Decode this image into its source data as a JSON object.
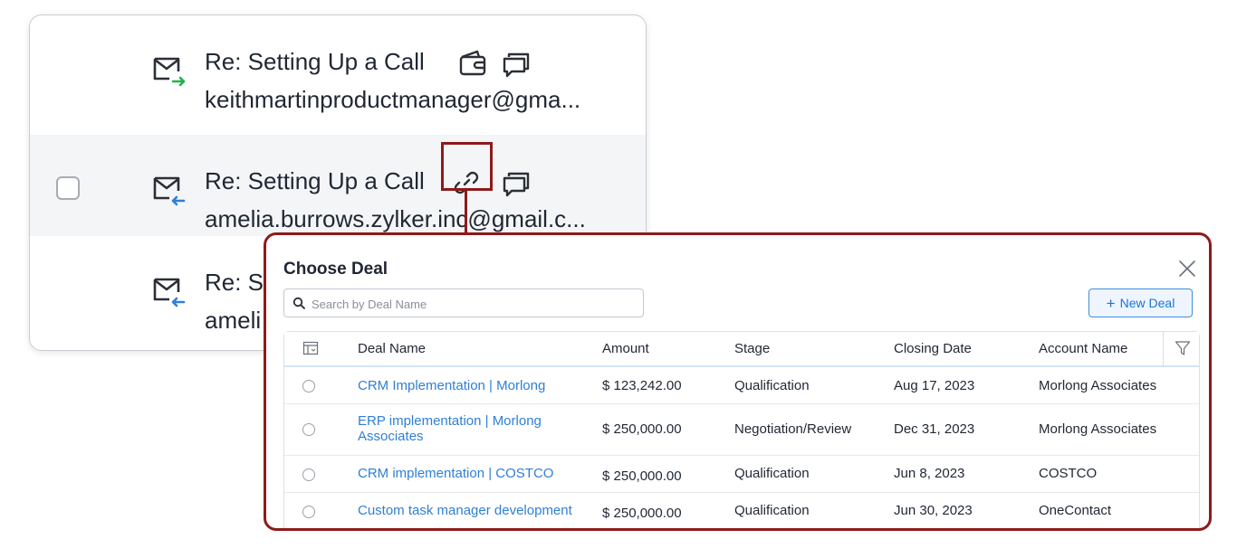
{
  "emails": [
    {
      "subject": "Re: Setting Up a Call",
      "from": "keithmartinproductmanager@gma...",
      "direction": "outgoing",
      "icons": [
        "wallet-icon",
        "comment-icon"
      ],
      "highlighted": false,
      "has_checkbox": false
    },
    {
      "subject": "Re: Setting Up a Call",
      "from": "amelia.burrows.zylker.inc@gmail.c...",
      "direction": "incoming",
      "icons": [
        "link-icon",
        "comment-icon"
      ],
      "highlighted": true,
      "has_checkbox": true
    },
    {
      "subject": "Re: S",
      "from": "ameli",
      "direction": "incoming",
      "icons": [],
      "highlighted": false,
      "has_checkbox": false
    }
  ],
  "dialog": {
    "title": "Choose Deal",
    "search_placeholder": "Search by Deal Name",
    "new_deal_label": "New Deal",
    "columns": [
      "Deal Name",
      "Amount",
      "Stage",
      "Closing Date",
      "Account Name"
    ],
    "rows": [
      {
        "deal_name": "CRM Implementation | Morlong",
        "amount": "$ 123,242.00",
        "stage": "Qualification",
        "closing_date": "Aug 17, 2023",
        "account_name": "Morlong Associates"
      },
      {
        "deal_name": "ERP implementation | Morlong Associates",
        "amount": "$ 250,000.00",
        "stage": "Negotiation/Review",
        "closing_date": "Dec 31, 2023",
        "account_name": "Morlong Associates"
      },
      {
        "deal_name": "CRM implementation | COSTCO",
        "amount": "$ 250,000.00",
        "stage": "Qualification",
        "closing_date": "Jun 8, 2023",
        "account_name": "COSTCO"
      },
      {
        "deal_name": "Custom task manager development",
        "amount": "$ 250,000.00",
        "stage": "Qualification",
        "closing_date": "Jun 30, 2023",
        "account_name": "OneContact"
      }
    ]
  },
  "colors": {
    "accent": "#1a73d8",
    "link": "#2f7fd6",
    "callout": "#8e1a1a",
    "outgoing_arrow": "#22b34a",
    "incoming_arrow": "#2f7fd6",
    "row_highlight": "#f4f5f7"
  }
}
